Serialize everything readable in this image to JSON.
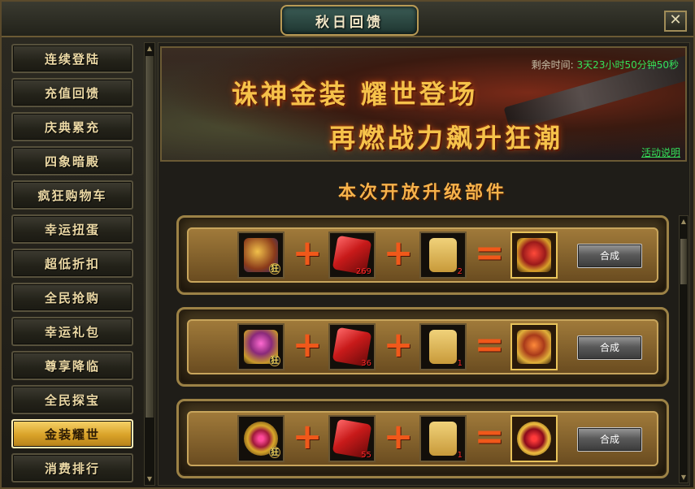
{
  "window": {
    "title": "秋日回馈",
    "close_label": "✕"
  },
  "sidebar": {
    "items": [
      {
        "label": "连续登陆"
      },
      {
        "label": "充值回馈"
      },
      {
        "label": "庆典累充"
      },
      {
        "label": "四象暗殿"
      },
      {
        "label": "疯狂购物车"
      },
      {
        "label": "幸运扭蛋"
      },
      {
        "label": "超低折扣"
      },
      {
        "label": "全民抢购"
      },
      {
        "label": "幸运礼包"
      },
      {
        "label": "尊享降临"
      },
      {
        "label": "全民探宝"
      },
      {
        "label": "金装耀世",
        "active": true
      },
      {
        "label": "消费排行"
      }
    ]
  },
  "banner": {
    "line1": "诛神金装  耀世登场",
    "line2": "再燃战力飙升狂潮",
    "remain_label": "剩余时间:",
    "remain_time": "3天23小时50分钟50秒",
    "info_link": "活动说明"
  },
  "section_title": "本次开放升级部件",
  "recipes": [
    {
      "base_icon": "armor-icon",
      "gem_count": "269",
      "scroll_count": "2",
      "result_icon": "result-armor-icon",
      "craft_label": "合成"
    },
    {
      "base_icon": "helmet-icon",
      "gem_count": "36",
      "scroll_count": "1",
      "result_icon": "result-helmet-icon",
      "craft_label": "合成"
    },
    {
      "base_icon": "ring-icon",
      "gem_count": "55",
      "scroll_count": "1",
      "result_icon": "result-ring-icon",
      "craft_label": "合成"
    }
  ],
  "glyphs": {
    "bound_mark": "狂",
    "plus": "+",
    "equals": "="
  },
  "colors": {
    "accent_gold": "#f7b24a",
    "timer_green": "#35e25a",
    "count_red": "#ff2a2a",
    "operator_orange": "#f0581a"
  }
}
